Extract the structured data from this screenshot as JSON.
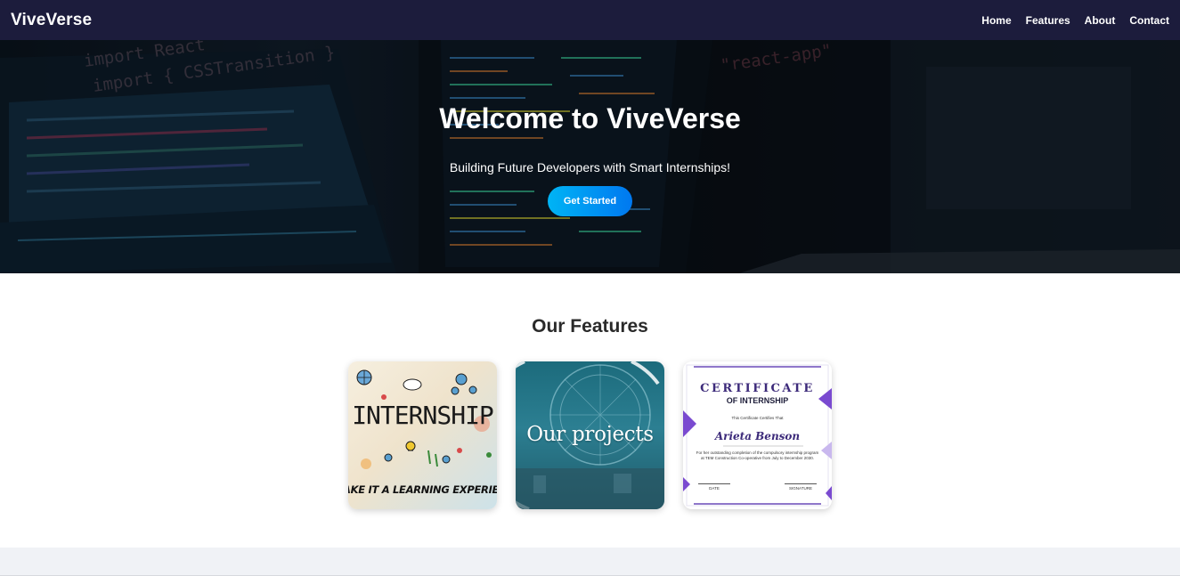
{
  "navbar": {
    "brand": "ViveVerse",
    "links": [
      "Home",
      "Features",
      "About",
      "Contact"
    ]
  },
  "hero": {
    "title": "Welcome to ViveVerse",
    "subtitle": "Building Future Developers with Smart Internships!",
    "cta_label": "Get Started",
    "bg_code_text": [
      "import React",
      "import { CSSTransition }",
      "\"react-app\""
    ]
  },
  "features": {
    "title": "Our Features",
    "cards": [
      {
        "name": "internship",
        "word": "INTERNSHIP",
        "tagline": "AKE IT A LEARNING EXPERIENCE"
      },
      {
        "name": "projects",
        "label": "Our projects"
      },
      {
        "name": "certificate",
        "title": "CERTIFICATE",
        "subtitle": "OF INTERNSHIP",
        "small": "This Certificate Certifies That",
        "recipient": "Arieta Benson",
        "body": "For her outstanding completion of the compulsory internship program at TEM Construction Co-operative from July to December 2030.",
        "date_label": "DATE",
        "signature_label": "SIGNATURE"
      }
    ]
  },
  "colors": {
    "navbar_bg": "#1c1c3c",
    "cta_gradient_start": "#00b4f5",
    "cta_gradient_end": "#0078f0",
    "certificate_accent": "#3c2a7a"
  }
}
